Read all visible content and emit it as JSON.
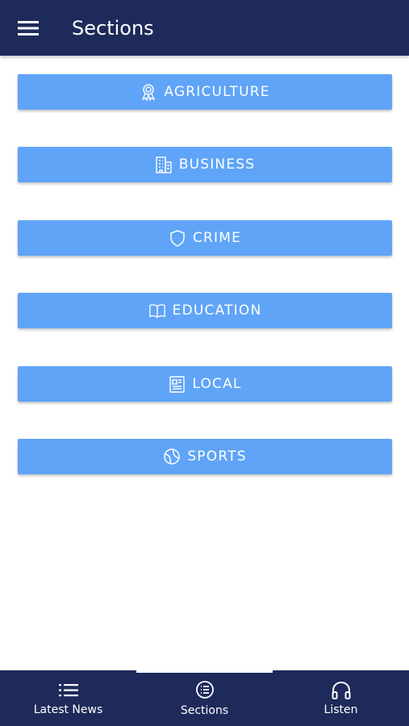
{
  "app_bar": {
    "title": "Sections",
    "menu_icon": "hamburger-menu-icon"
  },
  "sections": [
    {
      "label": "AGRICULTURE",
      "icon": "award-ribbon-icon"
    },
    {
      "label": "BUSINESS",
      "icon": "building-icon"
    },
    {
      "label": "CRIME",
      "icon": "shield-icon"
    },
    {
      "label": "EDUCATION",
      "icon": "open-book-icon"
    },
    {
      "label": "LOCAL",
      "icon": "newspaper-icon"
    },
    {
      "label": "SPORTS",
      "icon": "globe-ball-icon"
    }
  ],
  "bottom_nav": {
    "items": [
      {
        "label": "Latest News",
        "icon": "list-icon",
        "active": false
      },
      {
        "label": "Sections",
        "icon": "circle-list-icon",
        "active": true
      },
      {
        "label": "Listen",
        "icon": "headphones-icon",
        "active": false
      }
    ]
  },
  "colors": {
    "app_bar": "#1e2a5a",
    "section_button": "#5fa4f7",
    "text": "#ffffff"
  }
}
